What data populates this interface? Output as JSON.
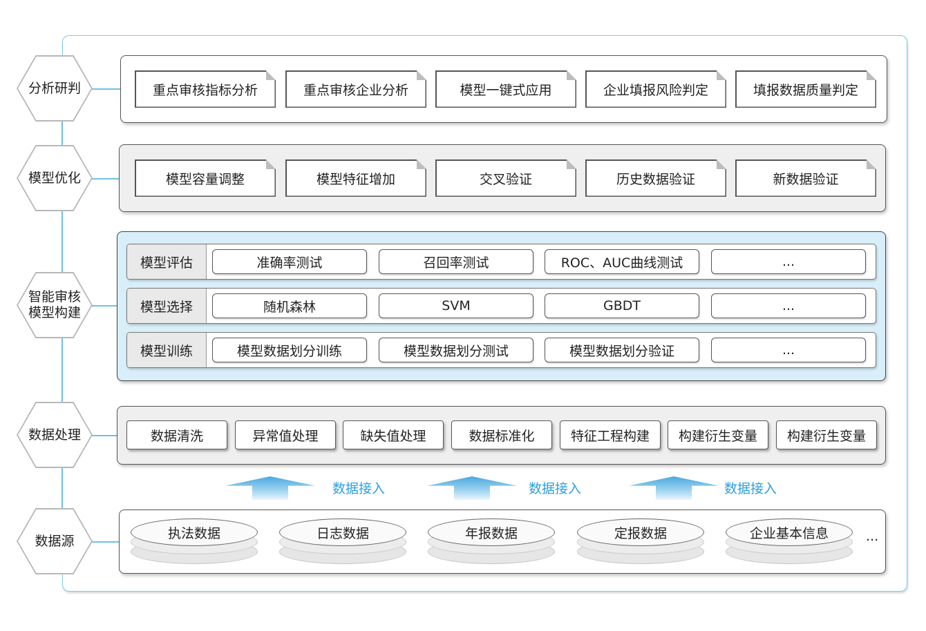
{
  "layers": {
    "analysis": {
      "label": "分析研判",
      "items": [
        "重点审核指标分析",
        "重点审核企业分析",
        "模型一键式应用",
        "企业填报风险判定",
        "填报数据质量判定"
      ]
    },
    "optimization": {
      "label": "模型优化",
      "items": [
        "模型容量调整",
        "模型特征增加",
        "交叉验证",
        "历史数据验证",
        "新数据验证"
      ]
    },
    "build": {
      "label": "智能审核\n模型构建",
      "rows": [
        {
          "label": "模型评估",
          "items": [
            "准确率测试",
            "召回率测试",
            "ROC、AUC曲线测试",
            "..."
          ]
        },
        {
          "label": "模型选择",
          "items": [
            "随机森林",
            "SVM",
            "GBDT",
            "..."
          ]
        },
        {
          "label": "模型训练",
          "items": [
            "模型数据划分训练",
            "模型数据划分测试",
            "模型数据划分验证",
            "..."
          ]
        }
      ]
    },
    "processing": {
      "label": "数据处理",
      "items": [
        "数据清洗",
        "异常值处理",
        "缺失值处理",
        "数据标准化",
        "特征工程构建",
        "构建衍生变量",
        "构建衍生变量"
      ]
    },
    "ingest": {
      "labels": [
        "数据接入",
        "数据接入",
        "数据接入"
      ]
    },
    "source": {
      "label": "数据源",
      "items": [
        "执法数据",
        "日志数据",
        "年报数据",
        "定报数据",
        "企业基本信息"
      ],
      "more": "..."
    }
  },
  "colors": {
    "frame": "#7fcbe6",
    "arrow": "#4aa8de",
    "ingest_text": "#2b9fe0",
    "build_panel": "#d8eef8"
  }
}
